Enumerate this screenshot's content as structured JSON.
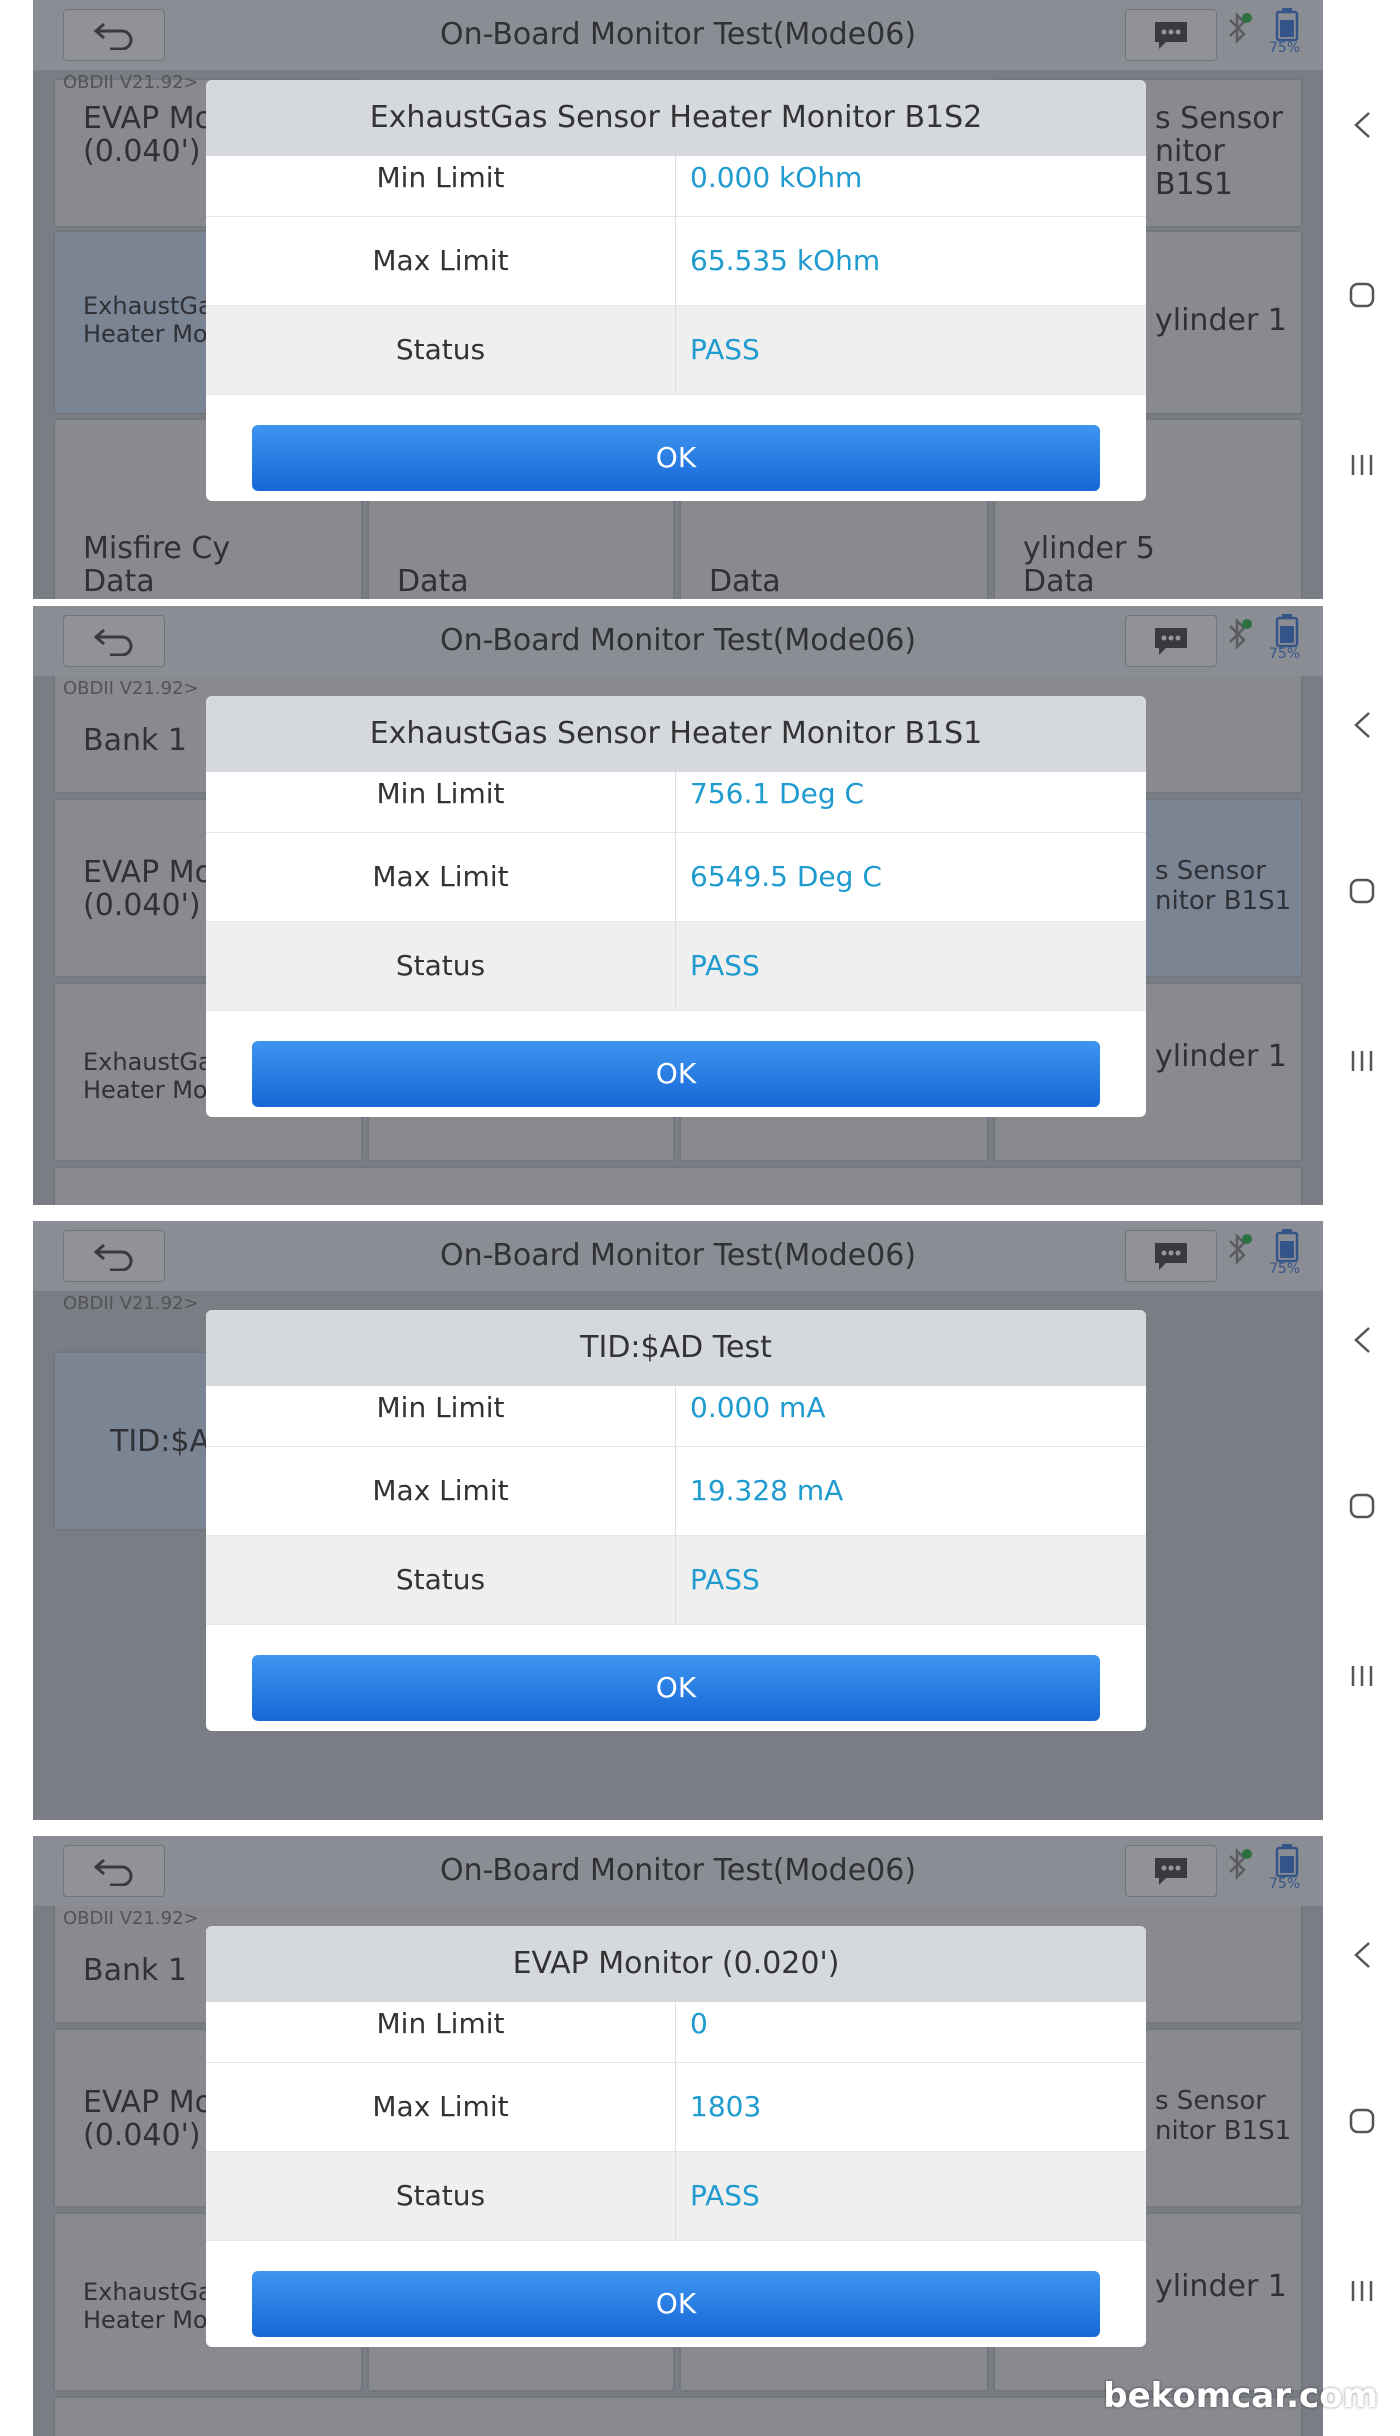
{
  "app_title": "On-Board Monitor Test(Mode06)",
  "battery_level": "75%",
  "breadcrumb": "OBDII V21.92>",
  "ok_label": "OK",
  "watermark": "bekomcar.com",
  "colors": {
    "value_text": "#1f9bcf",
    "ok_button": "#1f75e0",
    "dialog_header": "#d5d8dd"
  },
  "panels": [
    {
      "tiles": [
        {
          "label": "EVAP Mo\n(0.040')"
        },
        {
          "label": "s Sensor\nnitor B1S1"
        },
        {
          "label": "ExhaustGa\nHeater Mo"
        },
        {
          "label": "ylinder 1"
        },
        {
          "label": "Misfire Cy\nData"
        },
        {
          "label": "Data"
        },
        {
          "label": "Data"
        },
        {
          "label": "ylinder 5\nData"
        }
      ],
      "dialog": {
        "title": "ExhaustGas Sensor Heater Monitor B1S2",
        "rows": [
          {
            "label": "Min Limit",
            "value": "0.000 kOhm"
          },
          {
            "label": "Max Limit",
            "value": "65.535 kOhm"
          },
          {
            "label": "Status",
            "value": "PASS"
          }
        ]
      }
    },
    {
      "tiles": [
        {
          "label": "Bank 1"
        },
        {
          "label": "EVAP Mo\n(0.040')"
        },
        {
          "label": "s Sensor\nnitor B1S1"
        },
        {
          "label": "ExhaustGa\nHeater Mo"
        },
        {
          "label": "ylinder 1"
        }
      ],
      "dialog": {
        "title": "ExhaustGas Sensor Heater Monitor B1S1",
        "rows": [
          {
            "label": "Min Limit",
            "value": "756.1 Deg C"
          },
          {
            "label": "Max Limit",
            "value": "6549.5 Deg C"
          },
          {
            "label": "Status",
            "value": "PASS"
          }
        ]
      }
    },
    {
      "tiles": [
        {
          "label": "TID:$A"
        }
      ],
      "dialog": {
        "title": "TID:$AD Test",
        "rows": [
          {
            "label": "Min Limit",
            "value": "0.000 mA"
          },
          {
            "label": "Max Limit",
            "value": "19.328 mA"
          },
          {
            "label": "Status",
            "value": "PASS"
          }
        ]
      }
    },
    {
      "tiles": [
        {
          "label": "Bank 1"
        },
        {
          "label": "EVAP Mo\n(0.040')"
        },
        {
          "label": "s Sensor\nnitor B1S1"
        },
        {
          "label": "ExhaustGa\nHeater Mo"
        },
        {
          "label": "ylinder 1"
        }
      ],
      "dialog": {
        "title": "EVAP Monitor (0.020')",
        "rows": [
          {
            "label": "Min Limit",
            "value": "0"
          },
          {
            "label": "Max Limit",
            "value": "1803"
          },
          {
            "label": "Status",
            "value": "PASS"
          }
        ]
      }
    }
  ]
}
